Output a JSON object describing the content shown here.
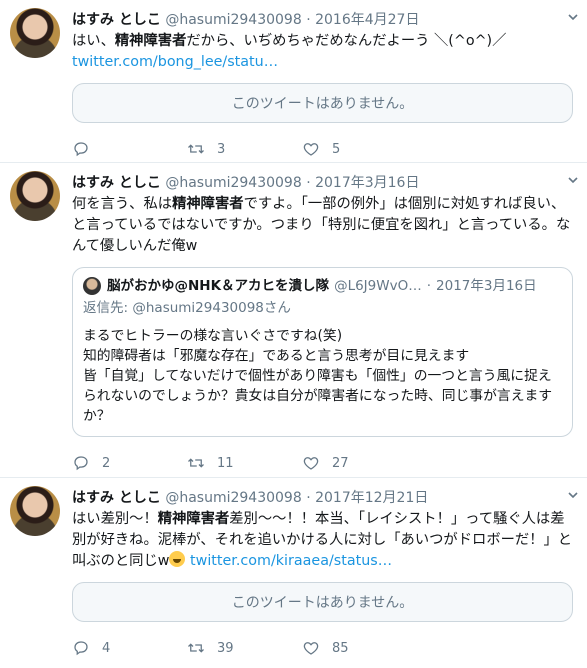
{
  "tweets": [
    {
      "name": "はすみ としこ",
      "handle": "@hasumi29430098",
      "dot": "·",
      "date": "2016年4月27日",
      "text_a": "はい、",
      "text_bold": "精神障害者",
      "text_b": "だから、いぢめちゃだめなんだよーう ＼(^o^)／",
      "link": "twitter.com/bong_lee/statu…",
      "unavailable": "このツイートはありません。",
      "replies": "",
      "retweets": "3",
      "likes": "5"
    },
    {
      "name": "はすみ としこ",
      "handle": "@hasumi29430098",
      "dot": "·",
      "date": "2017年3月16日",
      "text_a": "何を言う、私は",
      "text_bold": "精神障害者",
      "text_b": "ですよ。「一部の例外」は個別に対処すれば良い、と言っているではないですか。つまり「特別に便宜を図れ」と言っている。なんて優しいんだ俺w",
      "quote": {
        "name": "脳がおかゆ@NHK＆アカヒを潰し隊",
        "handle": "@L6J9WvO…",
        "dot": "·",
        "date": "2017年3月16日",
        "reply_prefix": "返信先:",
        "reply_to": "@hasumi29430098さん",
        "text": "まるでヒトラーの様な言いぐさですね(笑)\n知的障碍者は「邪魔な存在」であると言う思考が目に見えます\n皆「自覚」してないだけで個性があり障害も「個性」の一つと言う風に捉えられないのでしょうか？貴女は自分が障害者になった時、同じ事が言えますか？"
      },
      "replies": "2",
      "retweets": "11",
      "likes": "27"
    },
    {
      "name": "はすみ としこ",
      "handle": "@hasumi29430098",
      "dot": "·",
      "date": "2017年12月21日",
      "text_a": "はい差別～！",
      "text_bold": "精神障害者",
      "text_b": "差別～～！！本当、「レイシスト！」って騒ぐ人は差別が好きね。泥棒が、それを追いかける人に対し「あいつがドロボーだ！」と叫ぶのと同じw",
      "link": "twitter.com/kiraaea/status…",
      "unavailable": "このツイートはありません。",
      "replies": "4",
      "retweets": "39",
      "likes": "85"
    }
  ],
  "icons": [
    "reply-icon",
    "retweet-icon",
    "like-icon",
    "caret-down-icon",
    "rolling-laughing-emoji"
  ],
  "colors": {
    "link": "#1b95e0",
    "muted": "#657786",
    "border": "#e6ecf0"
  }
}
